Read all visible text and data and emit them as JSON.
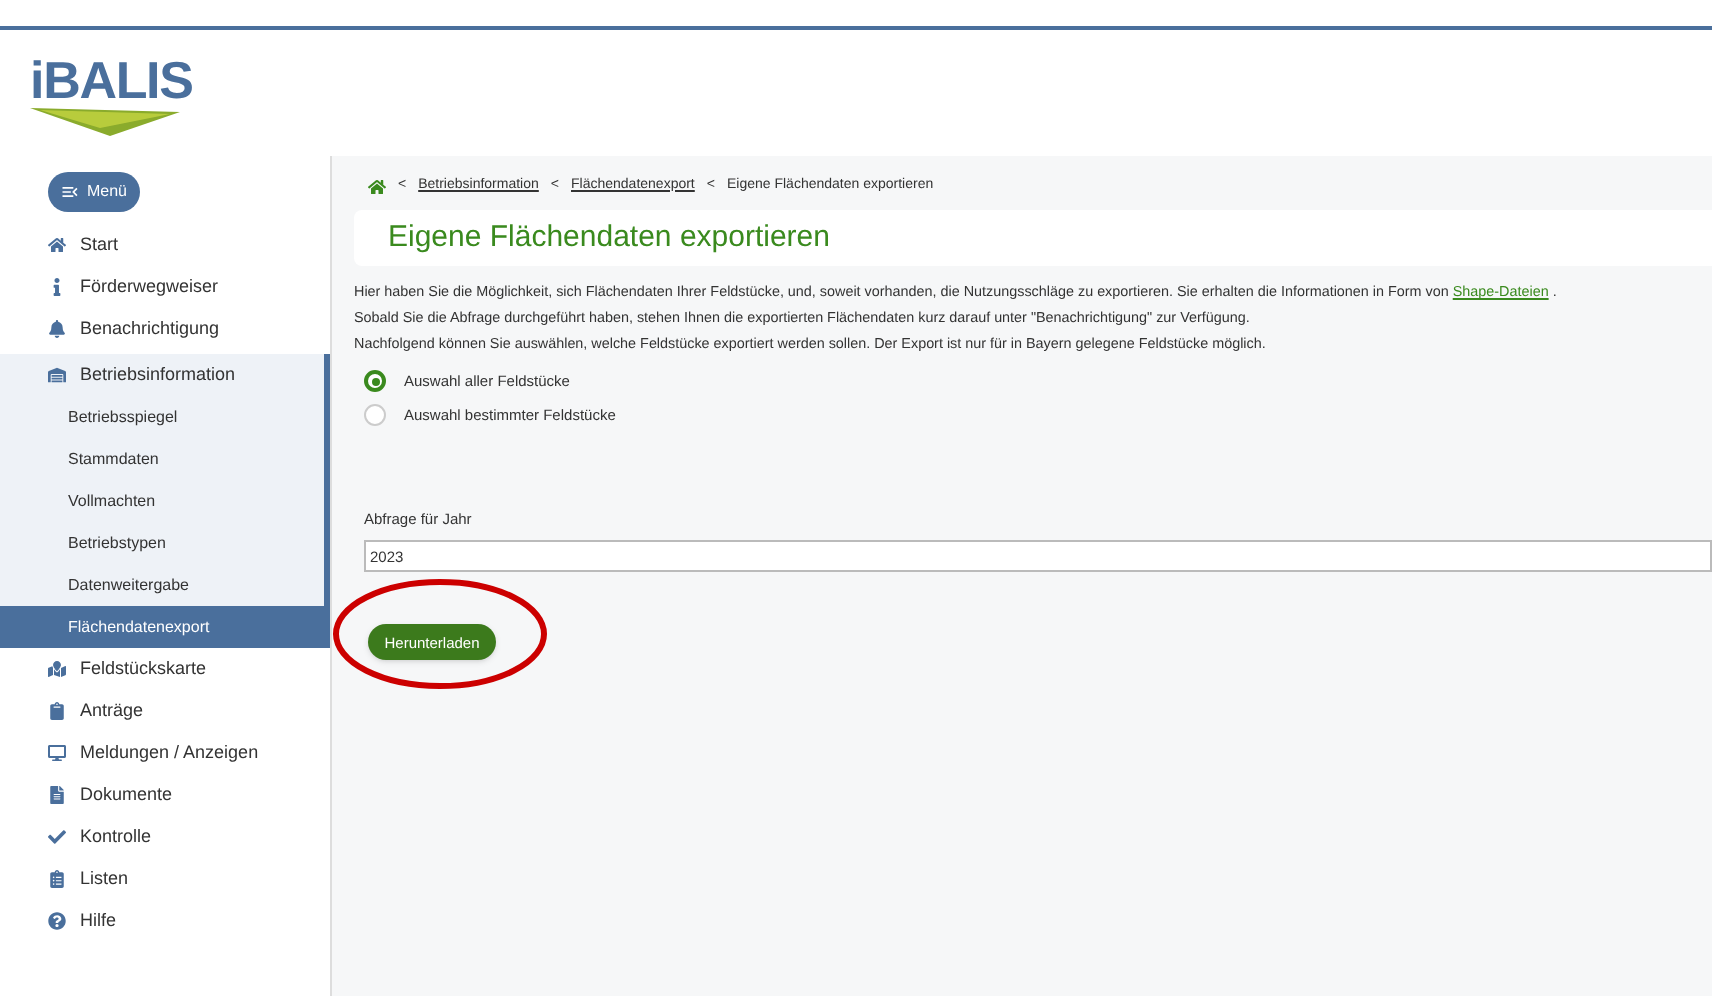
{
  "logo": {
    "text": "iBALIS"
  },
  "menu_button": {
    "label": "Menü"
  },
  "sidebar": {
    "items": [
      {
        "label": "Start",
        "selected": false
      },
      {
        "label": "Förderwegweiser",
        "selected": false
      },
      {
        "label": "Benachrichtigung",
        "selected": false
      },
      {
        "label": "Betriebsinformation",
        "selected": false,
        "children": [
          {
            "label": "Betriebsspiegel",
            "selected": false
          },
          {
            "label": "Stammdaten",
            "selected": false
          },
          {
            "label": "Vollmachten",
            "selected": false
          },
          {
            "label": "Betriebstypen",
            "selected": false
          },
          {
            "label": "Datenweitergabe",
            "selected": false
          },
          {
            "label": "Flächendatenexport",
            "selected": true
          }
        ]
      },
      {
        "label": "Feldstückskarte",
        "selected": false
      },
      {
        "label": "Anträge",
        "selected": false
      },
      {
        "label": "Meldungen / Anzeigen",
        "selected": false
      },
      {
        "label": "Dokumente",
        "selected": false
      },
      {
        "label": "Kontrolle",
        "selected": false
      },
      {
        "label": "Listen",
        "selected": false
      },
      {
        "label": "Hilfe",
        "selected": false
      }
    ]
  },
  "breadcrumb": [
    {
      "separator": "<",
      "label": "Betriebsinformation",
      "link": true
    },
    {
      "separator": "<",
      "label": "Flächendatenexport",
      "link": true
    },
    {
      "separator": "<",
      "label": "Eigene Flächendaten exportieren",
      "link": false
    }
  ],
  "page_title": "Eigene Flächendaten exportieren",
  "intro": {
    "text_before_link": "Hier haben Sie die Möglichkeit, sich Flächendaten Ihrer Feldstücke, und, soweit vorhanden, die Nutzungsschläge zu exportieren. Sie erhalten die Informationen in Form von",
    "link": "Shape-Dateien",
    "text_after_link": ".",
    "lines": [
      "Sobald Sie die Abfrage durchgeführt haben, stehen Ihnen die exportierten Flächendaten kurz darauf unter \"Benachrichtigung\" zur Verfügung.",
      "Nachfolgend können Sie auswählen, welche Feldstücke exportiert werden sollen. Der Export ist nur für in Bayern gelegene Feldstücke möglich."
    ]
  },
  "selection": [
    {
      "label": "Auswahl aller Feldstücke",
      "selected": true
    },
    {
      "label": "Auswahl bestimmter Feldstücke",
      "selected": false
    }
  ],
  "year_field": {
    "label": "Abfrage für Jahr",
    "value": "2023"
  },
  "download_button": {
    "label": "Herunterladen"
  }
}
